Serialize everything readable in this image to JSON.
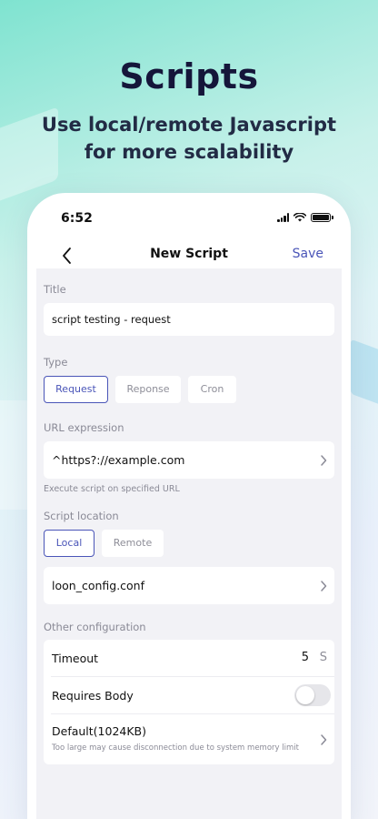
{
  "hero": {
    "title": "Scripts",
    "subtitle": "Use local/remote Javascript for more scalability"
  },
  "status_bar": {
    "time": "6:52",
    "icons": [
      "signal-icon",
      "wifi-icon",
      "battery-icon"
    ]
  },
  "navbar": {
    "back_icon": "chevron-left-icon",
    "title": "New Script",
    "save_label": "Save"
  },
  "form": {
    "title_section": {
      "label": "Title",
      "value": "script testing - request"
    },
    "type_section": {
      "label": "Type",
      "options": [
        "Request",
        "Reponse",
        "Cron"
      ],
      "selected": "Request"
    },
    "url_section": {
      "label": "URL expression",
      "value": "^https?://example.com",
      "hint": "Execute script on specified URL"
    },
    "location_section": {
      "label": "Script location",
      "options": [
        "Local",
        "Remote"
      ],
      "selected": "Local",
      "file": "loon_config.conf"
    },
    "other_section": {
      "label": "Other configuration",
      "timeout_label": "Timeout",
      "timeout_value": "5",
      "timeout_unit": "S",
      "requires_body_label": "Requires Body",
      "requires_body_on": false,
      "default_label": "Default(1024KB)",
      "default_hint": "Too large may cause disconnection due to system memory limit"
    }
  },
  "colors": {
    "accent": "#4a55b8",
    "hero_title": "#15163a",
    "background_top": "#7fe3d0",
    "form_background": "#f2f2f6"
  }
}
